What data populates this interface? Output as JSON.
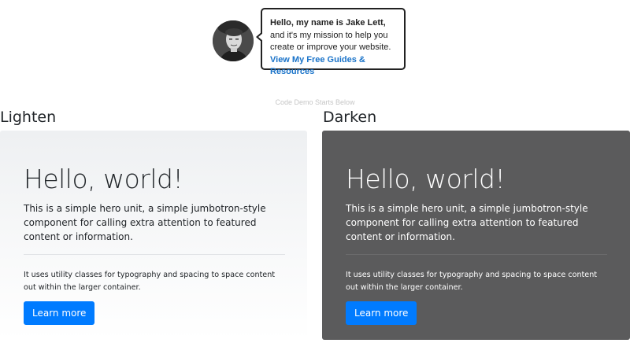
{
  "author_banner": {
    "greeting_bold": "Hello, my name is Jake Lett,",
    "greeting_rest": " and it's my mission to help you create or improve your website. ",
    "link_text": "View My Free Guides & Resources"
  },
  "demo_caption": "Code Demo Starts Below",
  "sections": {
    "lighten": {
      "title": "Lighten",
      "heading": "Hello, world!",
      "lead": "This is a simple hero unit, a simple jumbotron-style component for calling extra attention to featured content or information.",
      "body": "It uses utility classes for typography and spacing to space content out within the larger container.",
      "button_label": "Learn more"
    },
    "darken": {
      "title": "Darken",
      "heading": "Hello, world!",
      "lead": "This is a simple hero unit, a simple jumbotron-style component for calling extra attention to featured content or information.",
      "body": "It uses utility classes for typography and spacing to space content out within the larger container.",
      "button_label": "Learn more"
    }
  },
  "colors": {
    "primary_button": "#007bff",
    "link": "#1a73c9",
    "dark_background": "#5b5b5c"
  }
}
